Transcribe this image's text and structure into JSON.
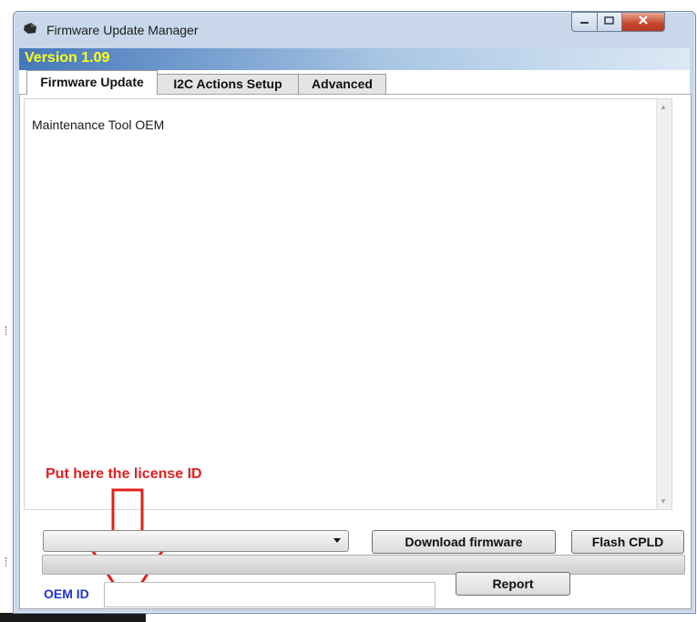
{
  "window": {
    "title": "Firmware Update Manager",
    "version_label": "Version 1.09",
    "controls": {
      "minimize": "minimize-icon",
      "maximize": "maximize-icon",
      "close": "close-icon"
    }
  },
  "tabs": [
    {
      "label": "Firmware Update",
      "active": true
    },
    {
      "label": "I2C Actions Setup",
      "active": false
    },
    {
      "label": "Advanced",
      "active": false
    }
  ],
  "main": {
    "log_text": "Maintenance Tool OEM",
    "annotation": "Put here the license ID",
    "firmware_select": {
      "selected": ""
    },
    "download_button": "Download firmware",
    "flash_button": "Flash CPLD",
    "progress": 0,
    "oem_label": "OEM ID",
    "oem_value": "",
    "report_button": "Report"
  },
  "colors": {
    "version_text": "#ffff1a",
    "annotation": "#e02020",
    "oem_label": "#2233cc",
    "close_button": "#c7452b"
  }
}
